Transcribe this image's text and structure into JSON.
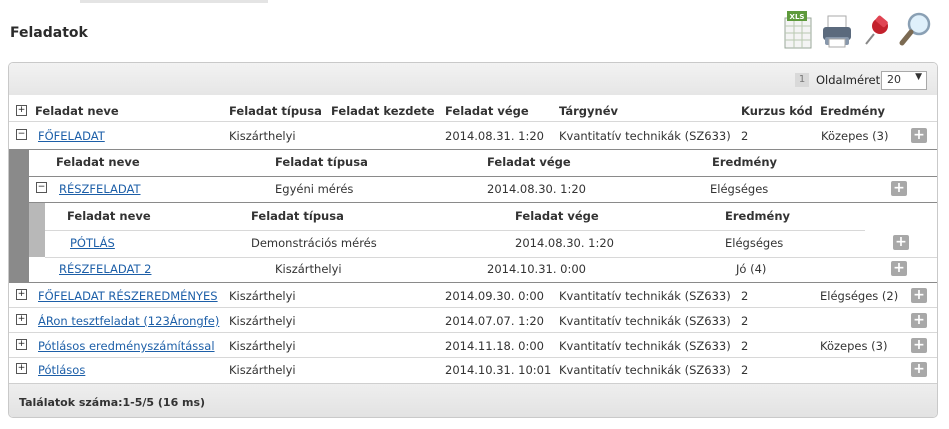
{
  "page": {
    "title": "Feladatok"
  },
  "toolbar": {
    "icons": [
      "xls-export-icon",
      "printer-icon",
      "pushpin-icon",
      "magnifier-icon"
    ],
    "xls_label": "XLS"
  },
  "pager": {
    "page": "1",
    "size_label": "Oldalméret",
    "size_value": "20"
  },
  "table": {
    "headers": [
      "Feladat neve",
      "Feladat típusa",
      "Feladat kezdete",
      "Feladat vége",
      "Tárgynév",
      "Kurzus kód",
      "Eredmény"
    ],
    "rows": [
      {
        "name": "FŐFELADAT",
        "type": "Kiszárthelyi",
        "end": "2014.08.31. 1:20",
        "subject": "Kvantitatív technikák (SZ633)",
        "code": "2",
        "result": "Közepes (3)"
      },
      {
        "name": "FŐFELADAT RÉSZEREDMÉNYES",
        "type": "Kiszárthelyi",
        "end": "2014.09.30. 0:00",
        "subject": "Kvantitatív technikák (SZ633)",
        "code": "2",
        "result": "Elégséges (2)"
      },
      {
        "name": "ÁRon tesztfeladat (123Árongfe)",
        "type": "Kiszárthelyi",
        "end": "2014.07.07. 1:20",
        "subject": "Kvantitatív technikák (SZ633)",
        "code": "2",
        "result": ""
      },
      {
        "name": "Pótlásos eredményszámítással",
        "type": "Kiszárthelyi",
        "end": "2014.11.18. 0:00",
        "subject": "Kvantitatív technikák (SZ633)",
        "code": "2",
        "result": "Közepes (3)"
      },
      {
        "name": "Pótlásos",
        "type": "Kiszárthelyi",
        "end": "2014.10.31. 10:01",
        "subject": "Kvantitatív technikák (SZ633)",
        "code": "2",
        "result": ""
      }
    ]
  },
  "subtable": {
    "headers": [
      "Feladat neve",
      "Feladat típusa",
      "Feladat vége",
      "Eredmény"
    ],
    "rows": [
      {
        "name": "RÉSZFELADAT",
        "type": "Egyéni mérés",
        "end": "2014.08.30. 1:20",
        "result": "Elégséges"
      },
      {
        "name": "RÉSZFELADAT 2",
        "type": "Kiszárthelyi",
        "end": "2014.10.31. 0:00",
        "result": "Jó (4)"
      }
    ]
  },
  "subsubtable": {
    "headers": [
      "Feladat neve",
      "Feladat típusa",
      "Feladat vége",
      "Eredmény"
    ],
    "rows": [
      {
        "name": "PÓTLÁS",
        "type": "Demonstrációs mérés",
        "end": "2014.08.30. 1:20",
        "result": "Elégséges"
      }
    ]
  },
  "footer": {
    "text": "Találatok száma:1-5/5 (16 ms)"
  }
}
